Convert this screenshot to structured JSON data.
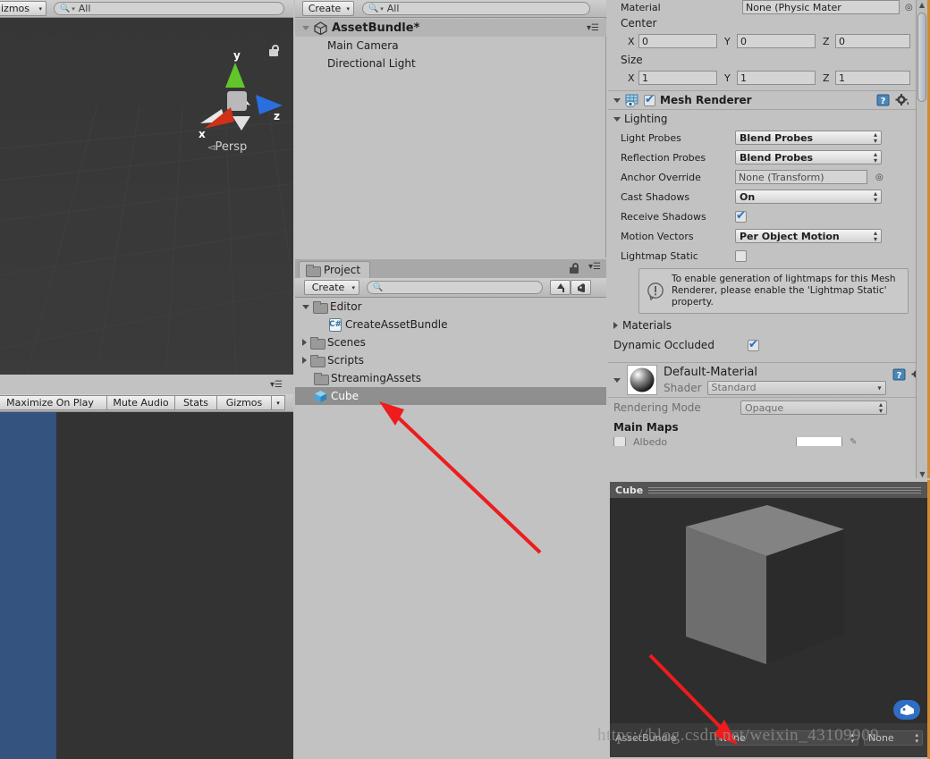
{
  "scene_view": {
    "toolbar": {
      "gizmos_label": "izmos",
      "search_placeholder": "All"
    },
    "gizmo": {
      "x_label": "x",
      "y_label": "y",
      "z_label": "z",
      "persp_label": "Persp"
    }
  },
  "game_view": {
    "toolbar": {
      "maximize_label": "Maximize On Play",
      "mute_label": "Mute Audio",
      "stats_label": "Stats",
      "gizmos_label": "Gizmos"
    }
  },
  "hierarchy": {
    "toolbar": {
      "create_label": "Create",
      "search_placeholder": "All"
    },
    "scene_name": "AssetBundle*",
    "items": [
      {
        "label": "Main Camera"
      },
      {
        "label": "Directional Light"
      }
    ]
  },
  "project": {
    "tab_label": "Project",
    "toolbar": {
      "create_label": "Create",
      "search_placeholder": ""
    },
    "rows": [
      {
        "label": "Editor",
        "icon": "folder-icon",
        "indent": 0,
        "arrow": "down",
        "selected": false
      },
      {
        "label": "CreateAssetBundle",
        "icon": "csharp-icon",
        "indent": 1,
        "arrow": "none",
        "selected": false
      },
      {
        "label": "Scenes",
        "icon": "folder-icon",
        "indent": 0,
        "arrow": "right",
        "selected": false
      },
      {
        "label": "Scripts",
        "icon": "folder-icon",
        "indent": 0,
        "arrow": "right",
        "selected": false
      },
      {
        "label": "StreamingAssets",
        "icon": "folder-icon",
        "indent": 0,
        "arrow": "none",
        "selected": false
      },
      {
        "label": "Cube",
        "icon": "cube-icon",
        "indent": 0,
        "arrow": "none",
        "selected": true
      }
    ]
  },
  "inspector": {
    "collider": {
      "material_label": "Material",
      "material_value": "None (Physic Mater",
      "center_label": "Center",
      "size_label": "Size",
      "center": {
        "x_axis": "X",
        "x": "0",
        "y_axis": "Y",
        "y": "0",
        "z_axis": "Z",
        "z": "0"
      },
      "size": {
        "x_axis": "X",
        "x": "1",
        "y_axis": "Y",
        "y": "1",
        "z_axis": "Z",
        "z": "1"
      }
    },
    "mesh_renderer": {
      "title": "Mesh Renderer",
      "enabled": true,
      "lighting_label": "Lighting",
      "props": [
        {
          "label": "Light Probes",
          "type": "popup",
          "value": "Blend Probes"
        },
        {
          "label": "Reflection Probes",
          "type": "popup",
          "value": "Blend Probes"
        },
        {
          "label": "Anchor Override",
          "type": "object",
          "value": "None (Transform)"
        },
        {
          "label": "Cast Shadows",
          "type": "popup",
          "value": "On"
        },
        {
          "label": "Receive Shadows",
          "type": "check",
          "value": "true"
        },
        {
          "label": "Motion Vectors",
          "type": "popup",
          "value": "Per Object Motion"
        },
        {
          "label": "Lightmap Static",
          "type": "check",
          "value": "false"
        }
      ],
      "help_text": "To enable generation of lightmaps for this Mesh Renderer, please enable the 'Lightmap Static' property.",
      "materials_label": "Materials",
      "dynamic_occluded_label": "Dynamic Occluded",
      "dynamic_occluded_value": "true"
    },
    "material": {
      "name": "Default-Material",
      "shader_label": "Shader",
      "shader_value": "Standard",
      "rendering_mode_label": "Rendering Mode",
      "rendering_mode_value": "Opaque",
      "main_maps_label": "Main Maps"
    }
  },
  "preview": {
    "title": "Cube",
    "assetbundle_label": "AssetBundle",
    "bundle_value": "None",
    "variant_value": "None"
  },
  "watermark": {
    "text": "https://blog.csdn.net/weixin_43109909"
  },
  "colors": {
    "panel_bg": "#c2c2c2",
    "scene_bg": "#393939",
    "game_sky": "#34537f",
    "selection": "#8f8f8f",
    "accent_arrow": "#ee1c1c",
    "focus_border": "#d08a33",
    "checkbox_blue": "#1f6fd0"
  }
}
